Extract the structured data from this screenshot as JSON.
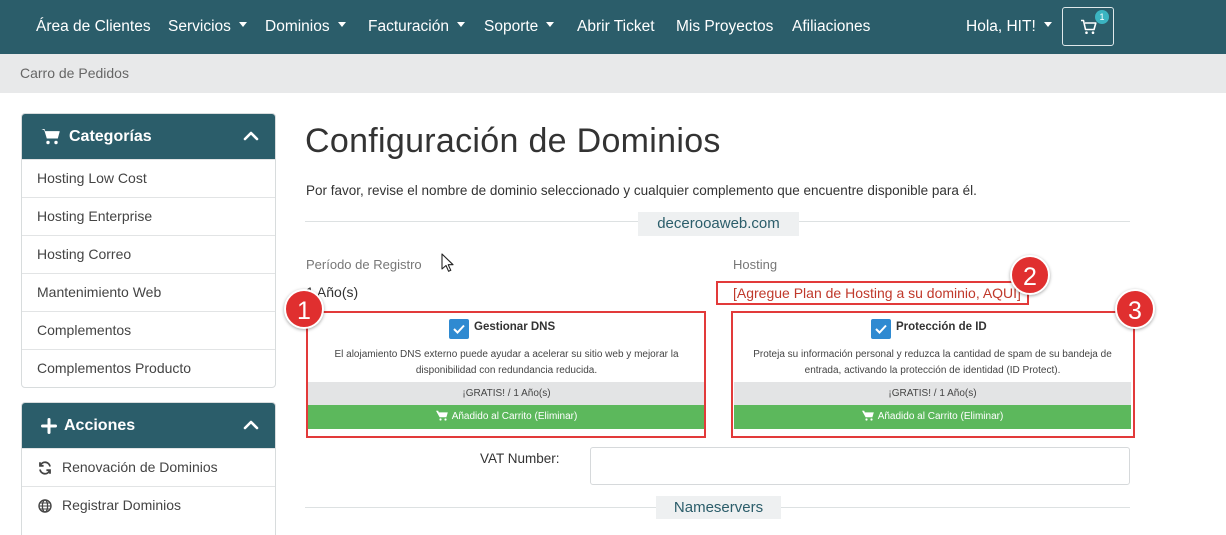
{
  "nav": {
    "items": [
      {
        "label": "Área de Clientes",
        "caret": false
      },
      {
        "label": "Servicios",
        "caret": true
      },
      {
        "label": "Dominios",
        "caret": true
      },
      {
        "label": "Facturación",
        "caret": true
      },
      {
        "label": "Soporte",
        "caret": true
      },
      {
        "label": "Abrir Ticket",
        "caret": false
      },
      {
        "label": "Mis Proyectos",
        "caret": false
      },
      {
        "label": "Afiliaciones",
        "caret": false
      }
    ],
    "user_label": "Hola, HIT!",
    "cart_count": "1",
    "color": "#2b5d6a"
  },
  "breadcrumb": "Carro de Pedidos",
  "sidebar": {
    "categories": {
      "title": "Categorías",
      "icon": "cart-icon",
      "items": [
        "Hosting Low Cost",
        "Hosting Enterprise",
        "Hosting Correo",
        "Mantenimiento Web",
        "Complementos",
        "Complementos Producto"
      ]
    },
    "actions": {
      "title": "Acciones",
      "icon": "plus-icon",
      "items": [
        {
          "label": "Renovación de Dominios",
          "icon": "refresh-icon"
        },
        {
          "label": "Registrar Dominios",
          "icon": "globe-icon"
        }
      ]
    }
  },
  "main": {
    "title": "Configuración de Dominios",
    "lead": "Por favor, revise el nombre de dominio seleccionado y cualquier complemento que encuentre disponible para él.",
    "domain": "decerooaweb.com",
    "period_label": "Período de Registro",
    "period_value": "1 Año(s)",
    "hosting_label": "Hosting",
    "hosting_link": "[Agregue Plan de Hosting a su dominio, AQUÍ]",
    "addons": [
      {
        "title": "Gestionar DNS",
        "checked": true,
        "description": "El alojamiento DNS externo puede ayudar a acelerar su sitio web y mejorar la disponibilidad con redundancia reducida.",
        "price": "¡GRATIS! / 1 Año(s)",
        "button": "Añadido al Carrito (Eliminar)"
      },
      {
        "title": "Protección de ID",
        "checked": true,
        "description": "Proteja su información personal y reduzca la cantidad de spam de su bandeja de entrada, activando la protección de identidad (ID Protect).",
        "price": "¡GRATIS! / 1 Año(s)",
        "button": "Añadido al Carrito (Eliminar)"
      }
    ],
    "vat_label": "VAT Number:",
    "vat_value": "",
    "nameservers_label": "Nameservers"
  },
  "annotations": [
    "1",
    "2",
    "3"
  ],
  "colors": {
    "accent": "#2b5d6a",
    "success": "#5cb85c",
    "annotation": "#e02f2f",
    "link_red": "#c0392b"
  }
}
